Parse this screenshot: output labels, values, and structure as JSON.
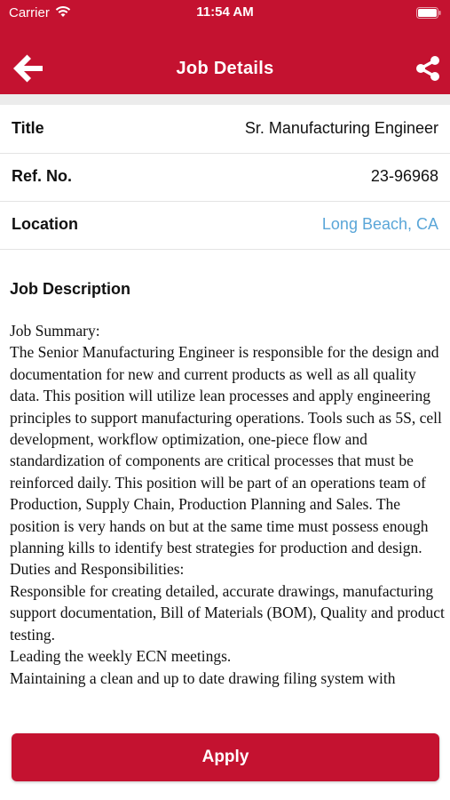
{
  "status_bar": {
    "carrier": "Carrier",
    "time": "11:54 AM"
  },
  "nav": {
    "title": "Job Details"
  },
  "details": [
    {
      "label": "Title",
      "value": "Sr. Manufacturing Engineer"
    },
    {
      "label": "Ref. No.",
      "value": "23-96968"
    },
    {
      "label": "Location",
      "value": "Long Beach, CA"
    }
  ],
  "description": {
    "heading": "Job Description",
    "paragraphs": [
      "Job Summary:",
      "The Senior Manufacturing Engineer is responsible for the design and documentation for new and current products as well as all quality data. This position will utilize lean processes and apply engineering principles to support manufacturing operations. Tools such as 5S, cell development, workflow optimization, one-piece flow and standardization of components are critical processes that must be reinforced daily. This position will be part of an operations team of Production, Supply Chain, Production Planning and Sales. The position is very hands on but at the same time must possess enough planning kills to identify best strategies for production and design.",
      "Duties and Responsibilities:",
      "Responsible for creating detailed, accurate drawings, manufacturing support documentation, Bill of Materials (BOM), Quality and product testing.",
      "Leading the weekly ECN meetings.",
      "Maintaining a clean and up to date drawing filing system with"
    ]
  },
  "apply_label": "Apply",
  "colors": {
    "brand": "#c41230",
    "link": "#5aa6d8"
  }
}
